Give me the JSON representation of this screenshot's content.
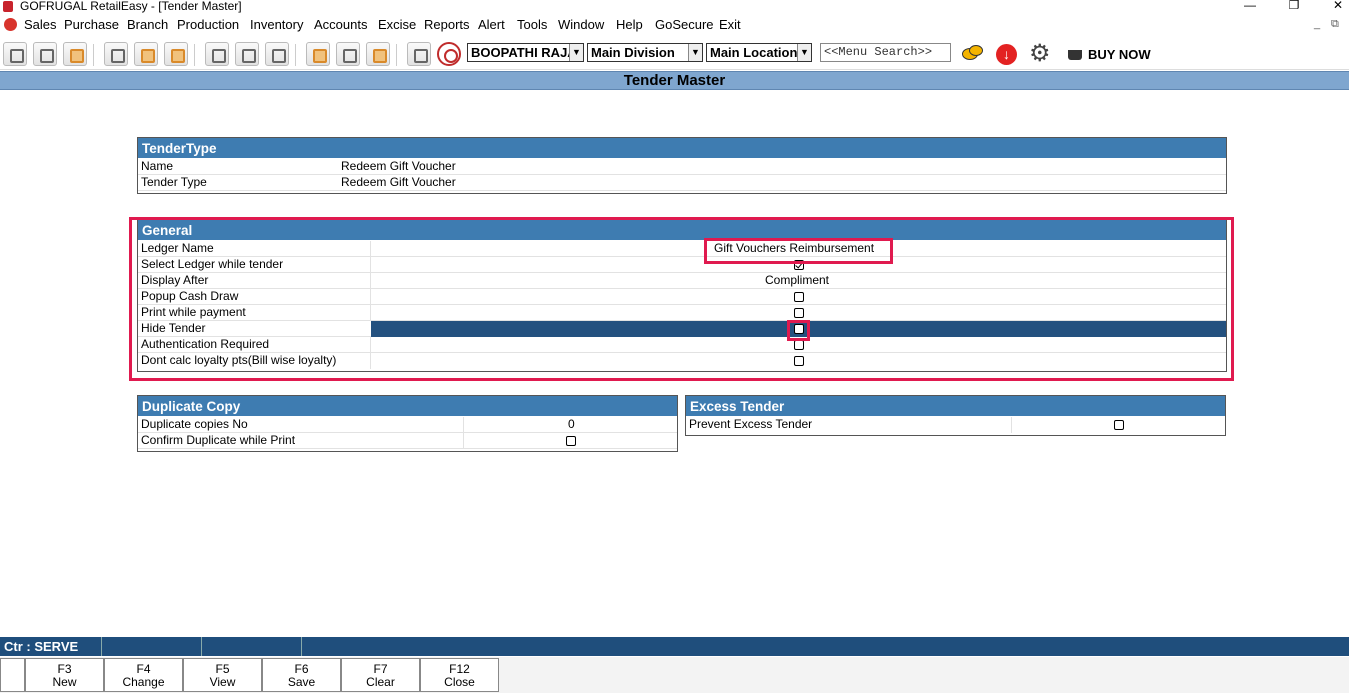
{
  "window": {
    "title": "GOFRUGAL RetailEasy - [Tender Master]",
    "minimize": "—",
    "maximize": "❐",
    "close": "✕",
    "mdi_min": "_",
    "mdi_restore": "⧉"
  },
  "menu": [
    "Sales",
    "Purchase",
    "Branch",
    "Production",
    "Inventory",
    "Accounts",
    "Excise",
    "Reports",
    "Alert",
    "Tools",
    "Window",
    "Help",
    "GoSecure",
    "Exit"
  ],
  "toolbar": {
    "user": "BOOPATHI RAJA",
    "division": "Main Division",
    "location": "Main Location",
    "search_placeholder": "<<Menu Search>>",
    "buy_now": "BUY NOW",
    "colors": {
      "down_button": "#e32222",
      "chat": "#f4b400"
    }
  },
  "page": {
    "title": "Tender Master"
  },
  "tender_type": {
    "header": "TenderType",
    "rows": [
      {
        "label": "Name",
        "value": "Redeem Gift Voucher"
      },
      {
        "label": "Tender Type",
        "value": "Redeem Gift Voucher"
      }
    ]
  },
  "general": {
    "header": "General",
    "ledger_name_label": "Ledger Name",
    "ledger_name_value": "Gift Vouchers Reimbursement",
    "select_ledger_label": "Select Ledger while tender",
    "select_ledger_checked": true,
    "display_after_label": "Display After",
    "display_after_value": "Compliment",
    "popup_cash_label": "Popup Cash Draw",
    "popup_cash_checked": false,
    "print_payment_label": "Print while payment",
    "print_payment_checked": false,
    "hide_tender_label": "Hide Tender",
    "hide_tender_checked": false,
    "auth_required_label": "Authentication Required",
    "auth_required_checked": false,
    "dont_calc_label": "Dont calc loyalty pts(Bill wise loyalty)",
    "dont_calc_checked": false
  },
  "duplicate_copy": {
    "header": "Duplicate Copy",
    "copies_label": "Duplicate copies No",
    "copies_value": "0",
    "confirm_label": "Confirm Duplicate while Print",
    "confirm_checked": false
  },
  "excess_tender": {
    "header": "Excess Tender",
    "prevent_label": "Prevent Excess Tender",
    "prevent_checked": false
  },
  "status": {
    "counter": "Ctr : SERVE"
  },
  "fkeys": [
    {
      "key": "F3",
      "label": "New"
    },
    {
      "key": "F4",
      "label": "Change"
    },
    {
      "key": "F5",
      "label": "View"
    },
    {
      "key": "F6",
      "label": "Save"
    },
    {
      "key": "F7",
      "label": "Clear"
    },
    {
      "key": "F12",
      "label": "Close"
    }
  ],
  "highlight_color": "#e01a4f"
}
